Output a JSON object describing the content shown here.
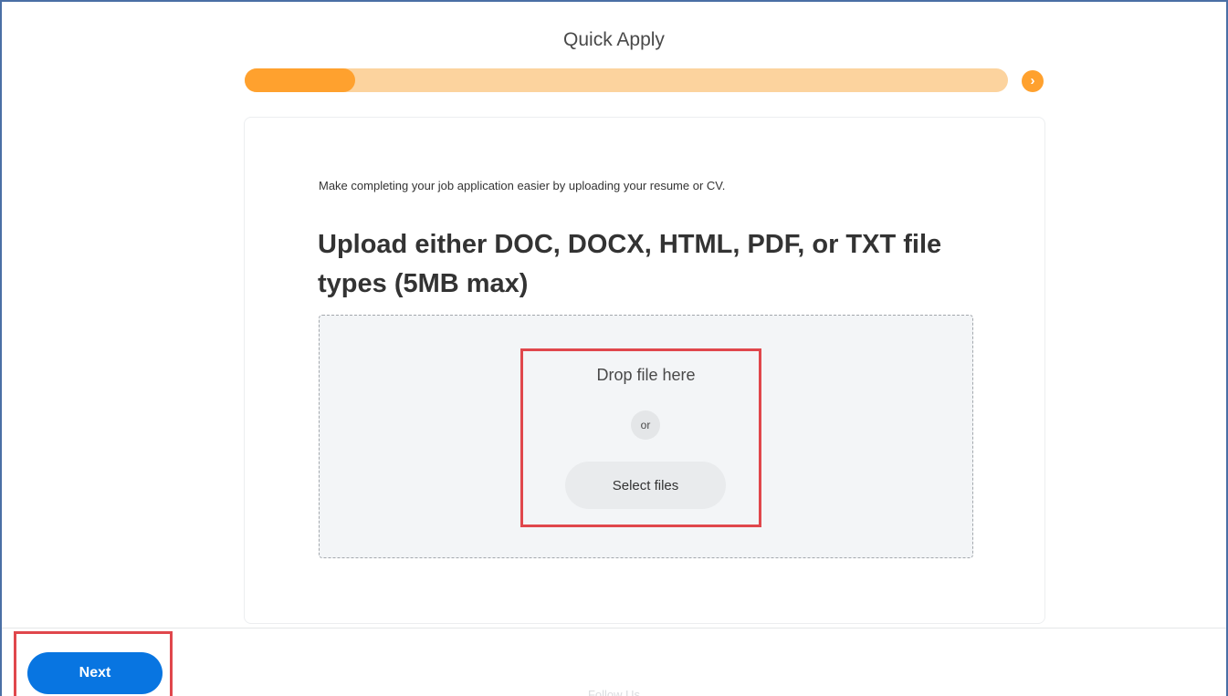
{
  "header": {
    "title": "Quick Apply"
  },
  "progress": {
    "fraction": 0.145,
    "next_icon": "chevron-right-icon",
    "next_glyph": "›"
  },
  "card": {
    "intro": "Make completing your job application easier by uploading your resume or CV.",
    "heading": "Upload either DOC, DOCX, HTML, PDF, or TXT file types (5MB max)"
  },
  "dropzone": {
    "drop_label": "Drop file here",
    "or_label": "or",
    "select_label": "Select files"
  },
  "footer": {
    "next_label": "Next",
    "follow_label": "Follow Us"
  },
  "colors": {
    "accent_orange": "#ffa12e",
    "track_orange": "#fcd39e",
    "primary_blue": "#0875e1",
    "highlight_red": "#e0474c"
  }
}
